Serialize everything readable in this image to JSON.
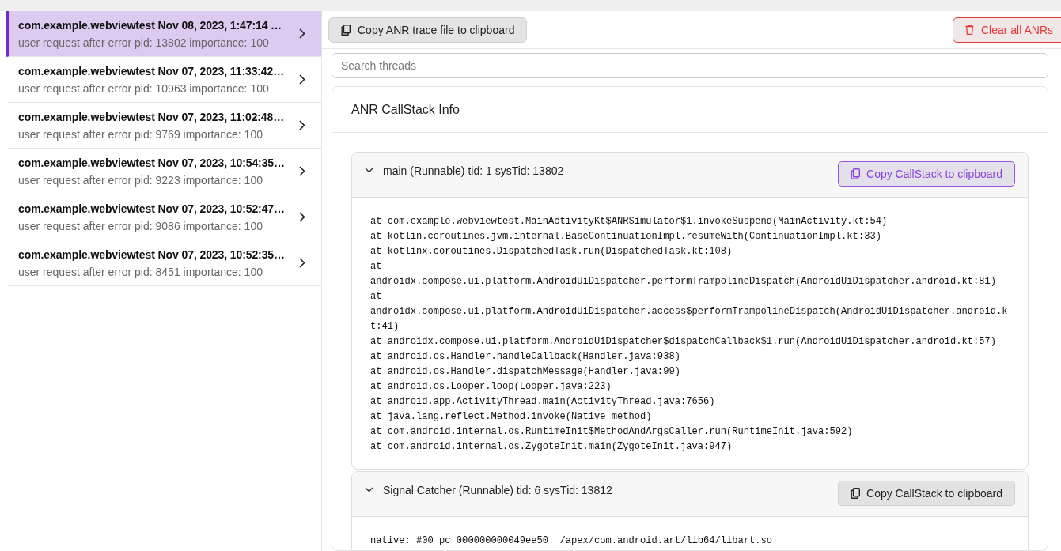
{
  "sidebar": {
    "items": [
      {
        "title": "com.example.webviewtest Nov 08, 2023, 1:47:14 …",
        "subtitle": "user request after error pid: 13802 importance: 100",
        "selected": true
      },
      {
        "title": "com.example.webviewtest Nov 07, 2023, 11:33:42…",
        "subtitle": "user request after error pid: 10963 importance: 100",
        "selected": false
      },
      {
        "title": "com.example.webviewtest Nov 07, 2023, 11:02:48…",
        "subtitle": "user request after error pid: 9769 importance: 100",
        "selected": false
      },
      {
        "title": "com.example.webviewtest Nov 07, 2023, 10:54:35…",
        "subtitle": "user request after error pid: 9223 importance: 100",
        "selected": false
      },
      {
        "title": "com.example.webviewtest Nov 07, 2023, 10:52:47…",
        "subtitle": "user request after error pid: 9086 importance: 100",
        "selected": false
      },
      {
        "title": "com.example.webviewtest Nov 07, 2023, 10:52:35…",
        "subtitle": "user request after error pid: 8451 importance: 100",
        "selected": false
      }
    ]
  },
  "toolbar": {
    "copy_button": "Copy ANR trace file to clipboard",
    "clear_button": "Clear all ANRs"
  },
  "search": {
    "placeholder": "Search threads"
  },
  "callstack_panel": {
    "title": "ANR CallStack Info",
    "threads": [
      {
        "header": "main (Runnable) tid: 1 sysTid: 13802",
        "expanded": true,
        "copy_button": {
          "label": "Copy CallStack to clipboard",
          "focused": true
        },
        "lines": [
          "at com.example.webviewtest.MainActivityKt$ANRSimulator$1.invokeSuspend(MainActivity.kt:54)",
          "at kotlin.coroutines.jvm.internal.BaseContinuationImpl.resumeWith(ContinuationImpl.kt:33)",
          "at kotlinx.coroutines.DispatchedTask.run(DispatchedTask.kt:108)",
          "at",
          "androidx.compose.ui.platform.AndroidUiDispatcher.performTrampolineDispatch(AndroidUiDispatcher.android.kt:81)",
          "at",
          "androidx.compose.ui.platform.AndroidUiDispatcher.access$performTrampolineDispatch(AndroidUiDispatcher.android.k",
          "t:41)",
          "at androidx.compose.ui.platform.AndroidUiDispatcher$dispatchCallback$1.run(AndroidUiDispatcher.android.kt:57)",
          "at android.os.Handler.handleCallback(Handler.java:938)",
          "at android.os.Handler.dispatchMessage(Handler.java:99)",
          "at android.os.Looper.loop(Looper.java:223)",
          "at android.app.ActivityThread.main(ActivityThread.java:7656)",
          "at java.lang.reflect.Method.invoke(Native method)",
          "at com.android.internal.os.RuntimeInit$MethodAndArgsCaller.run(RuntimeInit.java:592)",
          "at com.android.internal.os.ZygoteInit.main(ZygoteInit.java:947)"
        ]
      },
      {
        "header": "Signal Catcher (Runnable) tid: 6 sysTid: 13812",
        "expanded": true,
        "copy_button": {
          "label": "Copy CallStack to clipboard",
          "focused": false
        },
        "lines": [
          "native: #00 pc 000000000049ee50  /apex/com.android.art/lib64/libart.so"
        ]
      }
    ]
  }
}
